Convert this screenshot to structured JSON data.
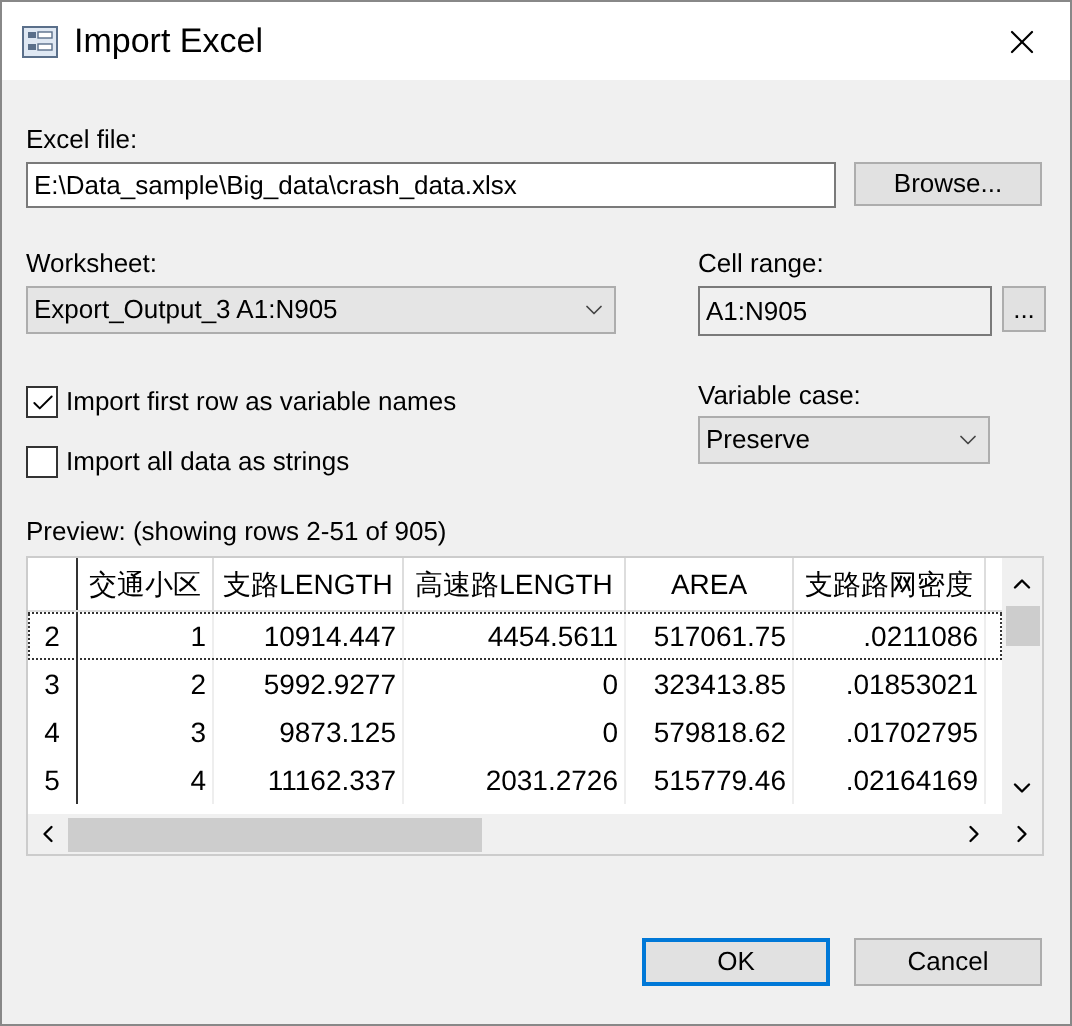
{
  "window": {
    "title": "Import Excel"
  },
  "excel_file": {
    "label": "Excel file:",
    "value": "E:\\Data_sample\\Big_data\\crash_data.xlsx",
    "browse": "Browse..."
  },
  "worksheet": {
    "label": "Worksheet:",
    "value": "Export_Output_3 A1:N905"
  },
  "cell_range": {
    "label": "Cell range:",
    "value": "A1:N905",
    "picker": "..."
  },
  "options": [
    {
      "label": "Import first row as variable names",
      "checked": true
    },
    {
      "label": "Import all data as strings",
      "checked": false
    }
  ],
  "variable_case": {
    "label": "Variable case:",
    "value": "Preserve"
  },
  "preview": {
    "label": "Preview: (showing rows 2-51 of 905)",
    "columns": [
      "交通小区",
      "支路LENGTH",
      "高速路LENGTH",
      "AREA",
      "支路路网密度"
    ],
    "rows": [
      {
        "number": "2",
        "selected": true,
        "cells": [
          "1",
          "10914.447",
          "4454.5611",
          "517061.75",
          ".0211086"
        ]
      },
      {
        "number": "3",
        "selected": false,
        "cells": [
          "2",
          "5992.9277",
          "0",
          "323413.85",
          ".01853021"
        ]
      },
      {
        "number": "4",
        "selected": false,
        "cells": [
          "3",
          "9873.125",
          "0",
          "579818.62",
          ".01702795"
        ]
      },
      {
        "number": "5",
        "selected": false,
        "cells": [
          "4",
          "11162.337",
          "2031.2726",
          "515779.46",
          ".02164169"
        ]
      }
    ]
  },
  "buttons": [
    {
      "label": "OK",
      "default": true
    },
    {
      "label": "Cancel",
      "default": false
    }
  ]
}
